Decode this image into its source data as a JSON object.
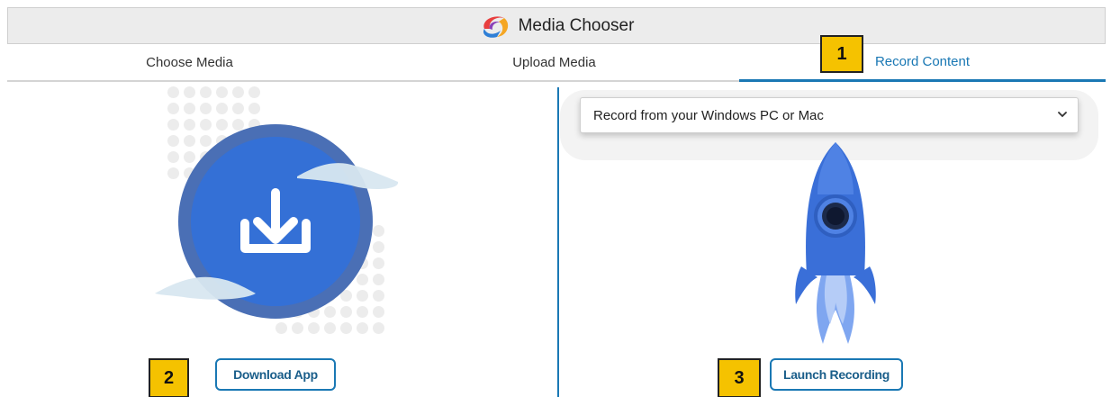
{
  "window": {
    "title": "Media Chooser",
    "logo_icon": "media-chooser-logo-icon"
  },
  "tabs": [
    {
      "label": "Choose Media",
      "active": false
    },
    {
      "label": "Upload Media",
      "active": false
    },
    {
      "label": "Record Content",
      "active": true
    }
  ],
  "badges": {
    "b1": "1",
    "b2": "2",
    "b3": "3",
    "color": "#f5c200"
  },
  "left_panel": {
    "illustration_icon": "download-icon",
    "button_label": "Download App"
  },
  "right_panel": {
    "select_value": "Record from your Windows PC or Mac",
    "illustration_icon": "rocket-icon",
    "button_label": "Launch Recording"
  },
  "colors": {
    "accent": "#1a78b4",
    "circle_blue": "#3470d6",
    "circle_rim": "#4a6fb5",
    "rocket_blue": "#3a6fd8"
  }
}
